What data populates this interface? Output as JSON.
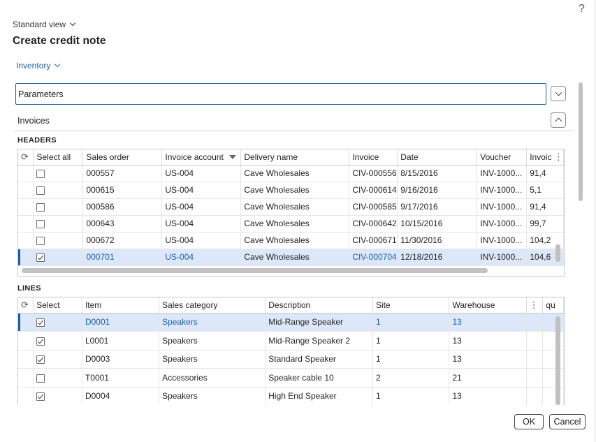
{
  "help_label": "?",
  "view_selector": "Standard view",
  "page_title": "Create credit note",
  "inventory_menu": "Inventory",
  "parameters_label": "Parameters",
  "invoices_label": "Invoices",
  "headers": {
    "section_label": "HEADERS",
    "columns": [
      "Select all",
      "Sales order",
      "Invoice account",
      "Delivery name",
      "Invoice",
      "Date",
      "Voucher",
      "Invoic"
    ],
    "rows": [
      {
        "checked": false,
        "sales_order": "000557",
        "invoice_account": "US-004",
        "delivery_name": "Cave Wholesales",
        "invoice": "CIV-000556",
        "date": "8/15/2016",
        "voucher": "INV-1000...",
        "amount": "91,4"
      },
      {
        "checked": false,
        "sales_order": "000615",
        "invoice_account": "US-004",
        "delivery_name": "Cave Wholesales",
        "invoice": "CIV-000614",
        "date": "9/16/2016",
        "voucher": "INV-1000...",
        "amount": "5,1"
      },
      {
        "checked": false,
        "sales_order": "000586",
        "invoice_account": "US-004",
        "delivery_name": "Cave Wholesales",
        "invoice": "CIV-000585",
        "date": "9/17/2016",
        "voucher": "INV-1000...",
        "amount": "91,4"
      },
      {
        "checked": false,
        "sales_order": "000643",
        "invoice_account": "US-004",
        "delivery_name": "Cave Wholesales",
        "invoice": "CIV-000642",
        "date": "10/15/2016",
        "voucher": "INV-1000...",
        "amount": "99,7"
      },
      {
        "checked": false,
        "sales_order": "000672",
        "invoice_account": "US-004",
        "delivery_name": "Cave Wholesales",
        "invoice": "CIV-000671",
        "date": "11/30/2016",
        "voucher": "INV-1000...",
        "amount": "104,2"
      },
      {
        "checked": true,
        "sales_order": "000701",
        "invoice_account": "US-004",
        "delivery_name": "Cave Wholesales",
        "invoice": "CIV-000704",
        "date": "12/18/2016",
        "voucher": "INV-1000...",
        "amount": "104,6"
      }
    ]
  },
  "lines": {
    "section_label": "LINES",
    "columns": [
      "Select",
      "Item",
      "Sales category",
      "Description",
      "Site",
      "Warehouse",
      "qu"
    ],
    "rows": [
      {
        "checked": true,
        "item": "D0001",
        "sales_category": "Speakers",
        "description": "Mid-Range Speaker",
        "site": "1",
        "warehouse": "13"
      },
      {
        "checked": true,
        "item": "L0001",
        "sales_category": "Speakers",
        "description": "Mid-Range Speaker 2",
        "site": "1",
        "warehouse": "13"
      },
      {
        "checked": true,
        "item": "D0003",
        "sales_category": "Speakers",
        "description": "Standard Speaker",
        "site": "1",
        "warehouse": "13"
      },
      {
        "checked": false,
        "item": "T0001",
        "sales_category": "Accessories",
        "description": "Speaker cable 10",
        "site": "2",
        "warehouse": "21"
      },
      {
        "checked": true,
        "item": "D0004",
        "sales_category": "Speakers",
        "description": "High End Speaker",
        "site": "1",
        "warehouse": "13"
      }
    ]
  },
  "buttons": {
    "ok": "OK",
    "cancel": "Cancel"
  },
  "colors": {
    "accent": "#1a5ea0",
    "link": "#1f5fab",
    "selected_row": "#dce8f9"
  }
}
